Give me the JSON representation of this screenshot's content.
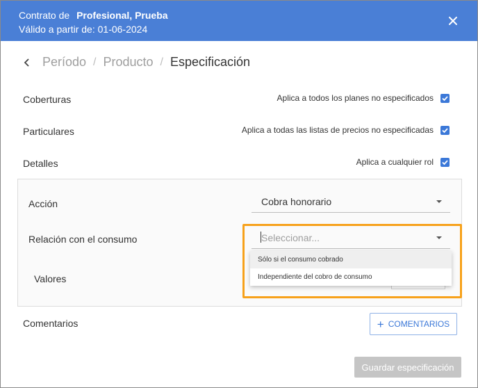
{
  "header": {
    "contract_prefix": "Contrato de",
    "contract_name": "Profesional, Prueba",
    "valid_from": "Válido a partir de: 01-06-2024"
  },
  "breadcrumb": {
    "items": [
      "Período",
      "Producto",
      "Especificación"
    ],
    "separator": "/"
  },
  "sections": {
    "coberturas": {
      "label": "Coberturas",
      "option": "Aplica a todos los planes no especificados",
      "checked": true
    },
    "particulares": {
      "label": "Particulares",
      "option": "Aplica a todas las listas de precios no especificadas",
      "checked": true
    },
    "detalles": {
      "label": "Detalles",
      "option": "Aplica a cualquier rol",
      "checked": true
    }
  },
  "panel": {
    "accion_label": "Acción",
    "accion_value": "Cobra honorario",
    "relacion_label": "Relación con el consumo",
    "relacion_placeholder": "Seleccionar...",
    "valores_label": "Valores",
    "dropdown_options": [
      "Sólo si el consumo cobrado",
      "Independiente del cobro de consumo"
    ]
  },
  "comentarios": {
    "label": "Comentarios",
    "button": "COMENTARIOS"
  },
  "footer": {
    "save_button": "Guardar especificación"
  },
  "colors": {
    "header": "#4a7fd6",
    "accent": "#3b78d8",
    "highlight": "#f7a11a",
    "disabled": "#c5c5c5"
  }
}
